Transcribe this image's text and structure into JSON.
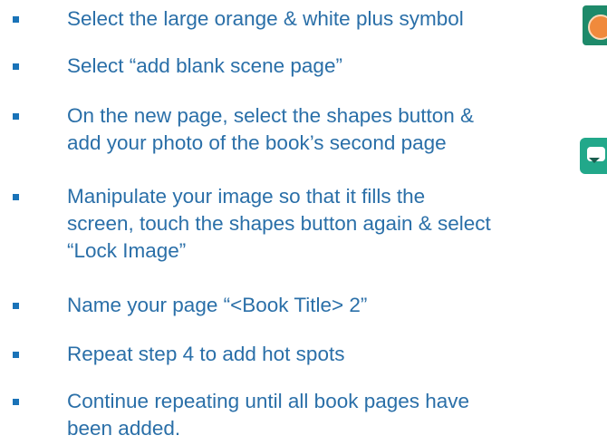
{
  "bullets": [
    {
      "text": "Select the large orange & white plus symbol"
    },
    {
      "text": "Select “add blank scene page”"
    },
    {
      "text": "On the new page, select the shapes button &\nadd your photo of the book’s second page"
    },
    {
      "text": "Manipulate your image so that it fills the\nscreen, touch the shapes button again & select\n“Lock Image”"
    },
    {
      "text": "Name your page “<Book Title> 2”"
    },
    {
      "text": "Repeat step 4 to add hot spots"
    },
    {
      "text": "Continue repeating until all book pages have\nbeen added."
    }
  ],
  "icons": {
    "add": "plus-orange-icon",
    "shapes": "shapes-chat-icon"
  },
  "colors": {
    "text": "#2a6fa8",
    "bullet": "#1a73b8",
    "add_bg": "#1e8a6a",
    "add_circle": "#f08a3c",
    "shapes_bg": "#22a88a"
  }
}
